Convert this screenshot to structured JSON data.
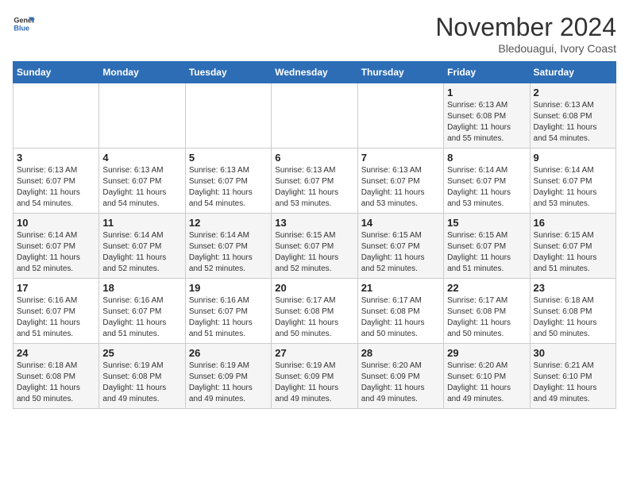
{
  "header": {
    "logo_line1": "General",
    "logo_line2": "Blue",
    "month": "November 2024",
    "location": "Bledouagui, Ivory Coast"
  },
  "weekdays": [
    "Sunday",
    "Monday",
    "Tuesday",
    "Wednesday",
    "Thursday",
    "Friday",
    "Saturday"
  ],
  "weeks": [
    [
      {
        "day": "",
        "info": ""
      },
      {
        "day": "",
        "info": ""
      },
      {
        "day": "",
        "info": ""
      },
      {
        "day": "",
        "info": ""
      },
      {
        "day": "",
        "info": ""
      },
      {
        "day": "1",
        "info": "Sunrise: 6:13 AM\nSunset: 6:08 PM\nDaylight: 11 hours\nand 55 minutes."
      },
      {
        "day": "2",
        "info": "Sunrise: 6:13 AM\nSunset: 6:08 PM\nDaylight: 11 hours\nand 54 minutes."
      }
    ],
    [
      {
        "day": "3",
        "info": "Sunrise: 6:13 AM\nSunset: 6:07 PM\nDaylight: 11 hours\nand 54 minutes."
      },
      {
        "day": "4",
        "info": "Sunrise: 6:13 AM\nSunset: 6:07 PM\nDaylight: 11 hours\nand 54 minutes."
      },
      {
        "day": "5",
        "info": "Sunrise: 6:13 AM\nSunset: 6:07 PM\nDaylight: 11 hours\nand 54 minutes."
      },
      {
        "day": "6",
        "info": "Sunrise: 6:13 AM\nSunset: 6:07 PM\nDaylight: 11 hours\nand 53 minutes."
      },
      {
        "day": "7",
        "info": "Sunrise: 6:13 AM\nSunset: 6:07 PM\nDaylight: 11 hours\nand 53 minutes."
      },
      {
        "day": "8",
        "info": "Sunrise: 6:14 AM\nSunset: 6:07 PM\nDaylight: 11 hours\nand 53 minutes."
      },
      {
        "day": "9",
        "info": "Sunrise: 6:14 AM\nSunset: 6:07 PM\nDaylight: 11 hours\nand 53 minutes."
      }
    ],
    [
      {
        "day": "10",
        "info": "Sunrise: 6:14 AM\nSunset: 6:07 PM\nDaylight: 11 hours\nand 52 minutes."
      },
      {
        "day": "11",
        "info": "Sunrise: 6:14 AM\nSunset: 6:07 PM\nDaylight: 11 hours\nand 52 minutes."
      },
      {
        "day": "12",
        "info": "Sunrise: 6:14 AM\nSunset: 6:07 PM\nDaylight: 11 hours\nand 52 minutes."
      },
      {
        "day": "13",
        "info": "Sunrise: 6:15 AM\nSunset: 6:07 PM\nDaylight: 11 hours\nand 52 minutes."
      },
      {
        "day": "14",
        "info": "Sunrise: 6:15 AM\nSunset: 6:07 PM\nDaylight: 11 hours\nand 52 minutes."
      },
      {
        "day": "15",
        "info": "Sunrise: 6:15 AM\nSunset: 6:07 PM\nDaylight: 11 hours\nand 51 minutes."
      },
      {
        "day": "16",
        "info": "Sunrise: 6:15 AM\nSunset: 6:07 PM\nDaylight: 11 hours\nand 51 minutes."
      }
    ],
    [
      {
        "day": "17",
        "info": "Sunrise: 6:16 AM\nSunset: 6:07 PM\nDaylight: 11 hours\nand 51 minutes."
      },
      {
        "day": "18",
        "info": "Sunrise: 6:16 AM\nSunset: 6:07 PM\nDaylight: 11 hours\nand 51 minutes."
      },
      {
        "day": "19",
        "info": "Sunrise: 6:16 AM\nSunset: 6:07 PM\nDaylight: 11 hours\nand 51 minutes."
      },
      {
        "day": "20",
        "info": "Sunrise: 6:17 AM\nSunset: 6:08 PM\nDaylight: 11 hours\nand 50 minutes."
      },
      {
        "day": "21",
        "info": "Sunrise: 6:17 AM\nSunset: 6:08 PM\nDaylight: 11 hours\nand 50 minutes."
      },
      {
        "day": "22",
        "info": "Sunrise: 6:17 AM\nSunset: 6:08 PM\nDaylight: 11 hours\nand 50 minutes."
      },
      {
        "day": "23",
        "info": "Sunrise: 6:18 AM\nSunset: 6:08 PM\nDaylight: 11 hours\nand 50 minutes."
      }
    ],
    [
      {
        "day": "24",
        "info": "Sunrise: 6:18 AM\nSunset: 6:08 PM\nDaylight: 11 hours\nand 50 minutes."
      },
      {
        "day": "25",
        "info": "Sunrise: 6:19 AM\nSunset: 6:08 PM\nDaylight: 11 hours\nand 49 minutes."
      },
      {
        "day": "26",
        "info": "Sunrise: 6:19 AM\nSunset: 6:09 PM\nDaylight: 11 hours\nand 49 minutes."
      },
      {
        "day": "27",
        "info": "Sunrise: 6:19 AM\nSunset: 6:09 PM\nDaylight: 11 hours\nand 49 minutes."
      },
      {
        "day": "28",
        "info": "Sunrise: 6:20 AM\nSunset: 6:09 PM\nDaylight: 11 hours\nand 49 minutes."
      },
      {
        "day": "29",
        "info": "Sunrise: 6:20 AM\nSunset: 6:10 PM\nDaylight: 11 hours\nand 49 minutes."
      },
      {
        "day": "30",
        "info": "Sunrise: 6:21 AM\nSunset: 6:10 PM\nDaylight: 11 hours\nand 49 minutes."
      }
    ]
  ]
}
